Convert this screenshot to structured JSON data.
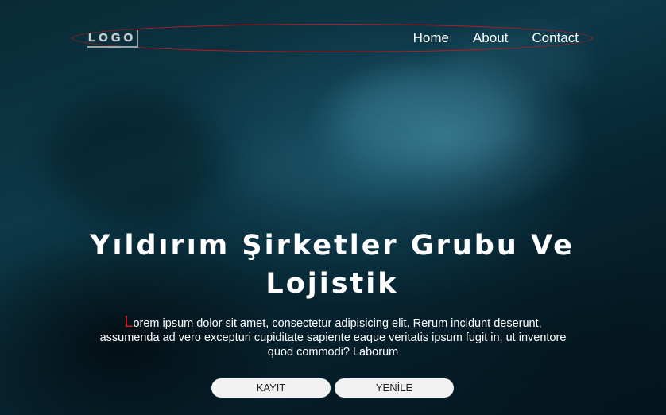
{
  "header": {
    "logo_text": "LOGO",
    "nav": [
      {
        "label": "Home"
      },
      {
        "label": "About"
      },
      {
        "label": "Contact"
      }
    ],
    "accent_color": "#c8161d"
  },
  "hero": {
    "title": "Yıldırım Şirketler Grubu Ve Lojistik",
    "description_first_letter": "L",
    "description_rest": "orem ipsum dolor sit amet, consectetur adipisicing elit. Rerum incidunt deserunt, assumenda ad vero excepturi cupiditate sapiente eaque veritatis ipsum fugit in, ut inventore quod commodi? Laborum",
    "drop_letter_color": "#d11a1f",
    "buttons": {
      "primary_label": "KAYIT",
      "secondary_label": "YENİLE"
    }
  }
}
